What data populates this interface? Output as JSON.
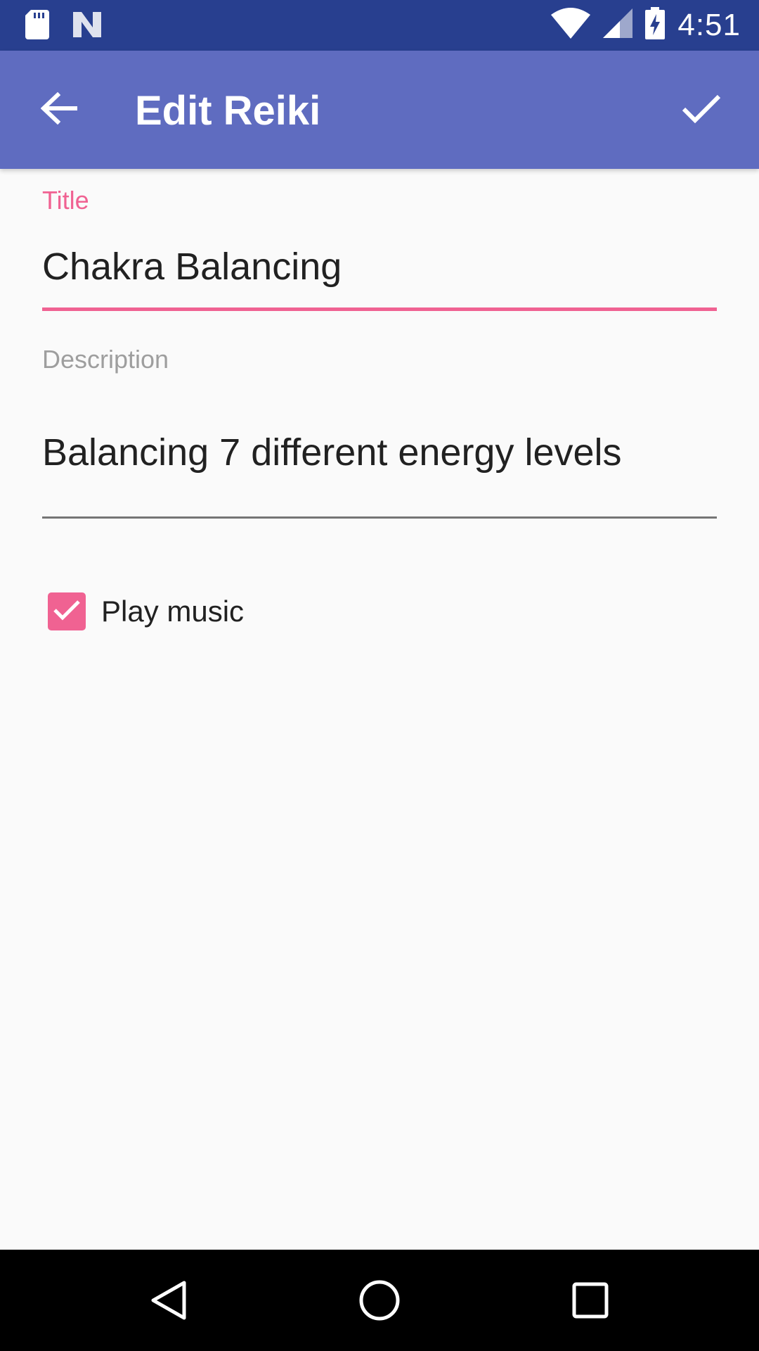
{
  "status_bar": {
    "time": "4:51",
    "icons": [
      "sd-card-icon",
      "n-notification-icon",
      "wifi-icon",
      "cell-signal-icon",
      "battery-charging-icon"
    ]
  },
  "app_bar": {
    "title": "Edit Reiki",
    "back_icon": "arrow-back-icon",
    "confirm_icon": "check-icon"
  },
  "form": {
    "title_label": "Title",
    "title_value": "Chakra Balancing",
    "description_label": "Description",
    "description_value": "Balancing 7 different energy levels",
    "play_music_label": "Play music",
    "play_music_checked": true
  },
  "nav_bar": {
    "icons": [
      "nav-back-icon",
      "nav-home-icon",
      "nav-recents-icon"
    ]
  },
  "colors": {
    "status_bar": "#283f8f",
    "app_bar": "#5f6cc0",
    "accent": "#f06292",
    "background": "#fafafa"
  }
}
